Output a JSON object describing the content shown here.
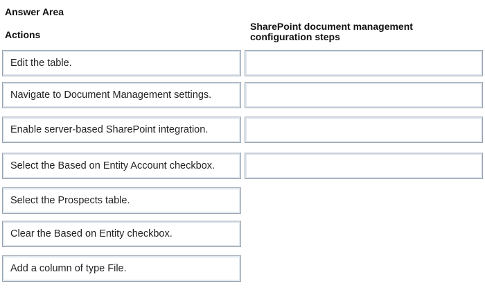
{
  "answer_area_title": "Answer Area",
  "actions_header": "Actions",
  "steps_header": "SharePoint document management configuration steps",
  "actions": [
    "Edit the table.",
    "Navigate to Document Management settings.",
    "Enable server-based SharePoint integration.",
    "Select the Based on Entity Account checkbox.",
    "Select the Prospects table.",
    "Clear the Based on Entity checkbox.",
    "Add a column of type File."
  ],
  "step_slots": [
    "",
    "",
    "",
    ""
  ]
}
